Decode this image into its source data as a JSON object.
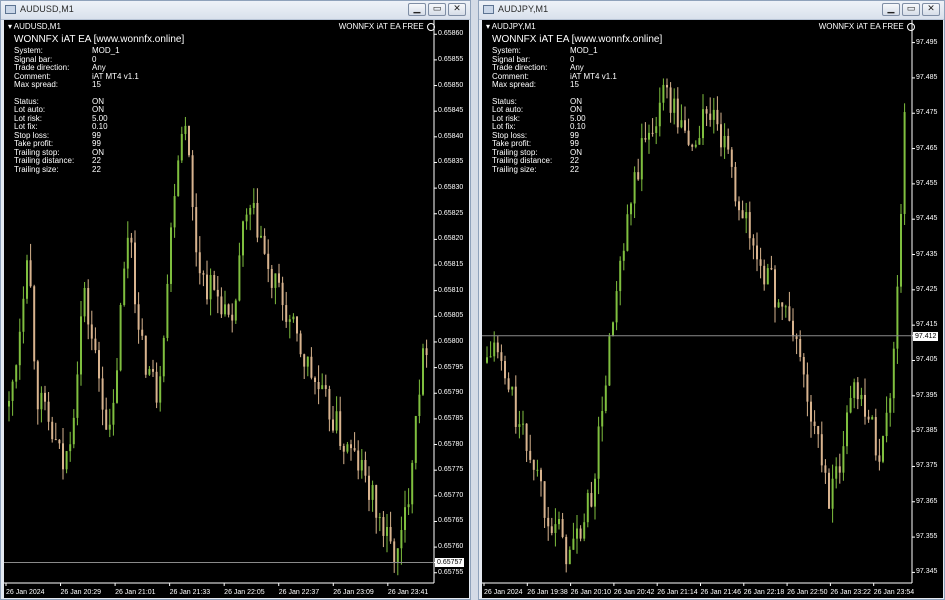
{
  "colors": {
    "background": "#000000",
    "candle_up": "#7fbf3f",
    "candle_down": "#d9b48f",
    "price_line": "#8a8a8a",
    "text": "#ffffff"
  },
  "windows": [
    {
      "id": "w1",
      "title": "AUDUSD,M1",
      "symbol_label": "AUDUSD,M1",
      "brand": "WONNFX iAT EA FREE",
      "panel": {
        "title": "WONNFX iAT EA [www.wonnfx.online]",
        "rows1": [
          {
            "k": "System:",
            "v": "MOD_1"
          },
          {
            "k": "Signal bar:",
            "v": "0"
          },
          {
            "k": "Trade direction:",
            "v": "Any"
          },
          {
            "k": "Comment:",
            "v": "iAT MT4 v1.1"
          },
          {
            "k": "Max spread:",
            "v": "15"
          }
        ],
        "rows2": [
          {
            "k": "Status:",
            "v": "ON"
          },
          {
            "k": "Lot auto:",
            "v": "ON"
          },
          {
            "k": "Lot risk:",
            "v": "5.00"
          },
          {
            "k": "Lot fix:",
            "v": "0.10"
          },
          {
            "k": "Stop loss:",
            "v": "99"
          },
          {
            "k": "Take profit:",
            "v": "99"
          },
          {
            "k": "Trailing stop:",
            "v": "ON"
          },
          {
            "k": "Trailing distance:",
            "v": "22"
          },
          {
            "k": "Trailing size:",
            "v": "22"
          }
        ]
      },
      "y_labels": [
        "0.65860",
        "0.65855",
        "0.65850",
        "0.65845",
        "0.65840",
        "0.65835",
        "0.65830",
        "0.65825",
        "0.65820",
        "0.65815",
        "0.65810",
        "0.65805",
        "0.65800",
        "0.65795",
        "0.65790",
        "0.65785",
        "0.65780",
        "0.65775",
        "0.65770",
        "0.65765",
        "0.65760",
        "0.65757",
        "0.65755"
      ],
      "current_price": "0.65757",
      "x_labels": [
        "26 Jan 2024",
        "26 Jan 20:29",
        "26 Jan 21:01",
        "26 Jan 21:33",
        "26 Jan 22:05",
        "26 Jan 22:37",
        "26 Jan 23:09",
        "26 Jan 23:41"
      ],
      "chart_data": {
        "type": "line",
        "series": [
          {
            "values": [
              0.65787,
              0.658,
              0.6582,
              0.6579,
              0.65785,
              0.6578,
              0.65775,
              0.65788,
              0.6581,
              0.658,
              0.6579,
              0.6578,
              0.65805,
              0.65825,
              0.658,
              0.65795,
              0.6579,
              0.6581,
              0.65835,
              0.65845,
              0.6582,
              0.65812,
              0.6581,
              0.65808,
              0.658,
              0.6582,
              0.65825,
              0.65822,
              0.65812,
              0.6581,
              0.65805,
              0.658,
              0.65796,
              0.65792,
              0.65788,
              0.65785,
              0.6578,
              0.65778,
              0.65775,
              0.6577,
              0.65765,
              0.6576,
              0.65758,
              0.6577,
              0.6579,
              0.658
            ]
          }
        ],
        "ylim": [
          0.65753,
          0.65862
        ]
      }
    },
    {
      "id": "w2",
      "title": "AUDJPY,M1",
      "symbol_label": "AUDJPY,M1",
      "brand": "WONNFX iAT EA FREE",
      "panel": {
        "title": "WONNFX iAT EA [www.wonnfx.online]",
        "rows1": [
          {
            "k": "System:",
            "v": "MOD_1"
          },
          {
            "k": "Signal bar:",
            "v": "0"
          },
          {
            "k": "Trade direction:",
            "v": "Any"
          },
          {
            "k": "Comment:",
            "v": "iAT MT4 v1.1"
          },
          {
            "k": "Max spread:",
            "v": "15"
          }
        ],
        "rows2": [
          {
            "k": "Status:",
            "v": "ON"
          },
          {
            "k": "Lot auto:",
            "v": "ON"
          },
          {
            "k": "Lot risk:",
            "v": "5.00"
          },
          {
            "k": "Lot fix:",
            "v": "0.10"
          },
          {
            "k": "Stop loss:",
            "v": "99"
          },
          {
            "k": "Take profit:",
            "v": "99"
          },
          {
            "k": "Trailing stop:",
            "v": "ON"
          },
          {
            "k": "Trailing distance:",
            "v": "22"
          },
          {
            "k": "Trailing size:",
            "v": "22"
          }
        ]
      },
      "y_labels": [
        "97.495",
        "97.485",
        "97.475",
        "97.465",
        "97.455",
        "97.445",
        "97.435",
        "97.425",
        "97.415",
        "97.412",
        "97.405",
        "97.395",
        "97.385",
        "97.375",
        "97.365",
        "97.355",
        "97.345"
      ],
      "current_price": "97.412",
      "x_labels": [
        "26 Jan 2024",
        "26 Jan 19:38",
        "26 Jan 20:10",
        "26 Jan 20:42",
        "26 Jan 21:14",
        "26 Jan 21:46",
        "26 Jan 22:18",
        "26 Jan 22:50",
        "26 Jan 23:22",
        "26 Jan 23:54"
      ],
      "chart_data": {
        "type": "line",
        "series": [
          {
            "values": [
              97.405,
              97.41,
              97.4,
              97.395,
              97.385,
              97.38,
              97.375,
              97.365,
              97.36,
              97.355,
              97.35,
              97.355,
              97.36,
              97.37,
              97.39,
              97.41,
              97.425,
              97.44,
              97.455,
              97.465,
              97.47,
              97.478,
              97.482,
              97.475,
              97.47,
              97.465,
              97.47,
              97.478,
              97.47,
              97.465,
              97.455,
              97.45,
              97.44,
              97.435,
              97.43,
              97.425,
              97.42,
              97.415,
              97.41,
              97.395,
              97.385,
              97.375,
              97.365,
              97.375,
              97.39,
              97.4,
              97.395,
              97.385,
              97.38,
              97.39,
              97.42,
              97.475
            ]
          }
        ],
        "ylim": [
          97.342,
          97.498
        ]
      }
    }
  ]
}
